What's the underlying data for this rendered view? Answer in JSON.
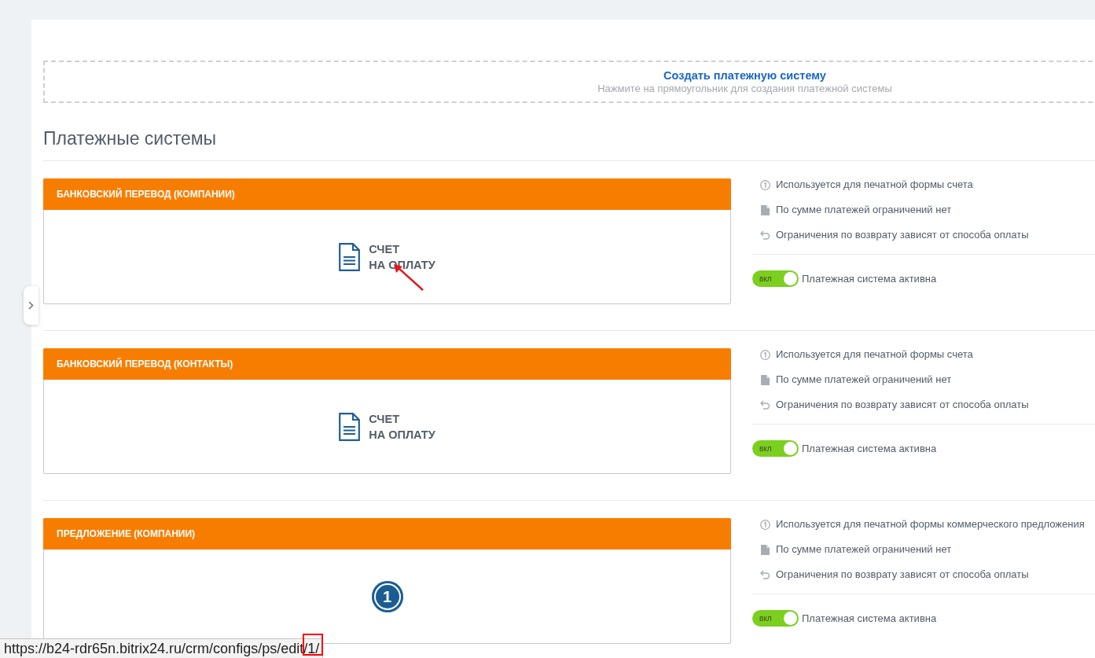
{
  "create_box": {
    "title": "Создать платежную систему",
    "hint": "Нажмите на прямоугольник для создания платежной системы"
  },
  "heading": "Платежные системы",
  "systems": [
    {
      "title": "БАНКОВСКИЙ ПЕРЕВОД (КОМПАНИИ)",
      "body": {
        "kind": "document",
        "label": "СЧЕТ\nНА ОПЛАТУ",
        "annotated": true
      },
      "info": [
        {
          "kind": "print",
          "text": "Используется для печатной формы счета"
        },
        {
          "kind": "sum",
          "text": "По сумме платежей ограничений нет"
        },
        {
          "kind": "return",
          "text": "Ограничения по возврату зависят от способа оплаты"
        }
      ],
      "toggle": {
        "on": true,
        "label": "вкл"
      },
      "status": "Платежная система активна"
    },
    {
      "title": "БАНКОВСКИЙ ПЕРЕВОД (КОНТАКТЫ)",
      "body": {
        "kind": "document",
        "label": "СЧЕТ\nНА ОПЛАТУ",
        "annotated": false
      },
      "info": [
        {
          "kind": "print",
          "text": "Используется для печатной формы счета"
        },
        {
          "kind": "sum",
          "text": "По сумме платежей ограничений нет"
        },
        {
          "kind": "return",
          "text": "Ограничения по возврату зависят от способа оплаты"
        }
      ],
      "toggle": {
        "on": true,
        "label": "вкл"
      },
      "status": "Платежная система активна"
    },
    {
      "title": "ПРЕДЛОЖЕНИЕ (КОМПАНИИ)",
      "body": {
        "kind": "badge",
        "label": "1",
        "annotated": false
      },
      "info": [
        {
          "kind": "print",
          "text": "Используется для печатной формы коммерческого предложения"
        },
        {
          "kind": "sum",
          "text": "По сумме платежей ограничений нет"
        },
        {
          "kind": "return",
          "text": "Ограничения по возврату зависят от способа оплаты"
        }
      ],
      "toggle": {
        "on": true,
        "label": "вкл"
      },
      "status": "Платежная система активна"
    }
  ],
  "status_bar": {
    "url": "https://b24-rdr65n.bitrix24.ru/crm/configs/ps/edit/1/",
    "annotated": true
  }
}
